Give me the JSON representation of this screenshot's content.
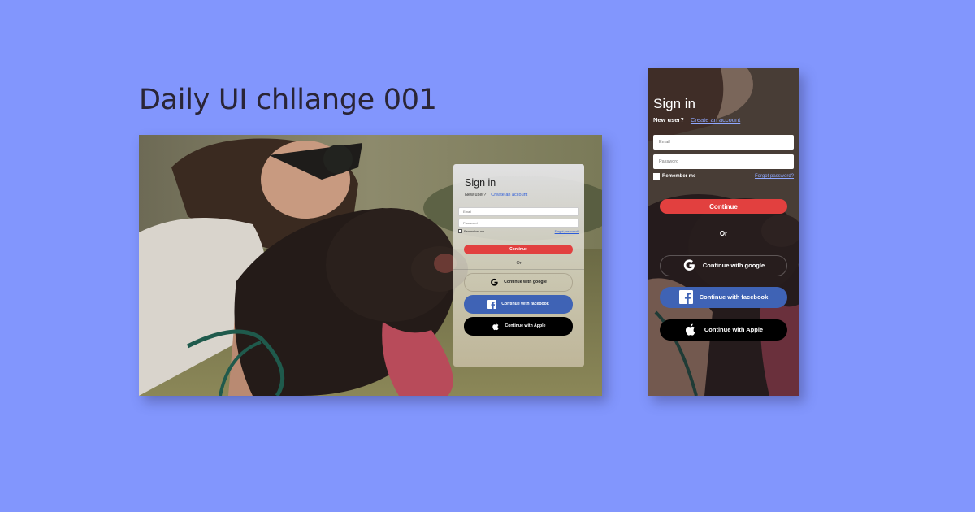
{
  "page": {
    "title": "Daily UI chllange 001",
    "background_color": "#8296fd"
  },
  "desktop": {
    "card": {
      "title": "Sign in",
      "new_user_text": "New user?",
      "create_account_link": "Create an account",
      "email_placeholder": "Email",
      "password_placeholder": "Password",
      "remember_me": "Remember me",
      "forgot_password": "Forgot password?",
      "continue_label": "Continue",
      "or_label": "Or",
      "google_label": "Continue with google",
      "facebook_label": "Continue with facebook",
      "apple_label": "Continue with Apple"
    }
  },
  "mobile": {
    "card": {
      "title": "Sign in",
      "new_user_text": "New user?",
      "create_account_link": "Create an account",
      "email_placeholder": "Email",
      "password_placeholder": "Password",
      "remember_me": "Remember me",
      "forgot_password": "Forgot password?",
      "continue_label": "Continue",
      "or_label": "Or",
      "google_label": "Continue with google",
      "facebook_label": "Continue with facebook",
      "apple_label": "Continue with Apple"
    }
  },
  "icons": [
    "google-icon",
    "facebook-icon",
    "apple-icon"
  ],
  "colors": {
    "continue_button": "#e2403f",
    "facebook_button": "#3f63b5",
    "apple_button": "#000000",
    "link": "#2d5cd8"
  }
}
